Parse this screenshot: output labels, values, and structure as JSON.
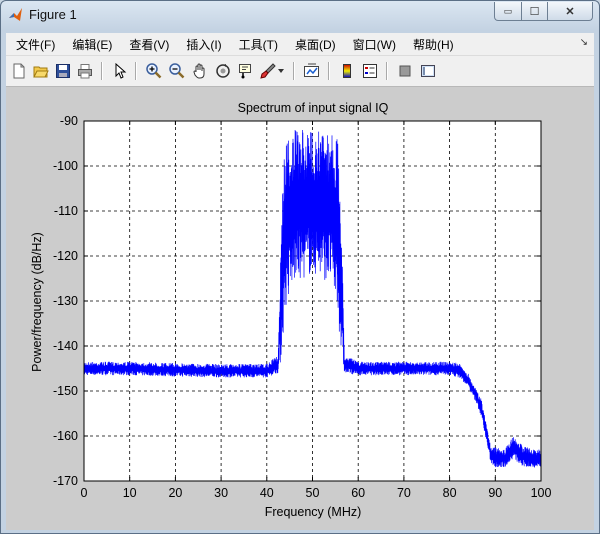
{
  "window": {
    "title": "Figure 1",
    "buttons": {
      "minimize": "▭",
      "maximize": "☐",
      "close": "✕"
    }
  },
  "menu": {
    "items": [
      "文件(F)",
      "编辑(E)",
      "查看(V)",
      "插入(I)",
      "工具(T)",
      "桌面(D)",
      "窗口(W)",
      "帮助(H)"
    ],
    "overflow_arrow": "↘"
  },
  "toolbar": {
    "icons": [
      "new-figure-icon",
      "open-file-icon",
      "save-icon",
      "print-icon",
      "edit-plot-arrow-icon",
      "zoom-in-icon",
      "zoom-out-icon",
      "pan-hand-icon",
      "rotate-3d-icon",
      "data-cursor-icon",
      "brush-icon",
      "brush-dropdown-icon",
      "link-plot-icon",
      "insert-colorbar-icon",
      "insert-legend-icon",
      "hide-plot-tools-icon",
      "show-plot-tools-icon"
    ]
  },
  "colors": {
    "line": "#0000ff",
    "axes_bg": "#ffffff",
    "figure_bg": "#cccccc"
  },
  "chart_data": {
    "type": "line",
    "title": "Spectrum of input signal IQ",
    "xlabel": "Frequency (MHz)",
    "ylabel": "Power/frequency (dB/Hz)",
    "xlim": [
      0,
      100
    ],
    "ylim": [
      -170,
      -90
    ],
    "xticks": [
      0,
      10,
      20,
      30,
      40,
      50,
      60,
      70,
      80,
      90,
      100
    ],
    "yticks": [
      -90,
      -100,
      -110,
      -120,
      -130,
      -140,
      -150,
      -160,
      -170
    ],
    "grid": true,
    "series": [
      {
        "color": "#0000ff",
        "upper": [
          [
            0,
            -143.5
          ],
          [
            10,
            -143.5
          ],
          [
            20,
            -143.8
          ],
          [
            30,
            -144
          ],
          [
            40,
            -144
          ],
          [
            42.5,
            -142
          ],
          [
            43.2,
            -110
          ],
          [
            44,
            -94
          ],
          [
            46,
            -92
          ],
          [
            50,
            -92
          ],
          [
            54,
            -92
          ],
          [
            55.5,
            -94
          ],
          [
            56.3,
            -110
          ],
          [
            57,
            -142
          ],
          [
            60,
            -143.5
          ],
          [
            70,
            -143.5
          ],
          [
            80,
            -143.5
          ],
          [
            82,
            -143.8
          ],
          [
            84,
            -146
          ],
          [
            86,
            -150
          ],
          [
            87,
            -152
          ],
          [
            88,
            -157
          ],
          [
            89,
            -162
          ],
          [
            90,
            -162.5
          ],
          [
            92,
            -163
          ],
          [
            94,
            -160
          ],
          [
            96,
            -162
          ],
          [
            98,
            -163
          ],
          [
            100,
            -163
          ]
        ],
        "lower": [
          [
            0,
            -146.5
          ],
          [
            10,
            -146.5
          ],
          [
            20,
            -146.8
          ],
          [
            30,
            -147
          ],
          [
            40,
            -147
          ],
          [
            42.5,
            -146
          ],
          [
            43.2,
            -143
          ],
          [
            44,
            -132
          ],
          [
            46,
            -126
          ],
          [
            50,
            -124
          ],
          [
            54,
            -126
          ],
          [
            55.5,
            -132
          ],
          [
            56.3,
            -143
          ],
          [
            57,
            -146
          ],
          [
            60,
            -146.5
          ],
          [
            70,
            -146.5
          ],
          [
            80,
            -146.5
          ],
          [
            82,
            -147
          ],
          [
            84,
            -149
          ],
          [
            86,
            -153
          ],
          [
            87,
            -156
          ],
          [
            88,
            -161
          ],
          [
            89,
            -166
          ],
          [
            90,
            -167
          ],
          [
            92,
            -167
          ],
          [
            94,
            -165
          ],
          [
            96,
            -167
          ],
          [
            98,
            -167
          ],
          [
            100,
            -167
          ]
        ]
      }
    ]
  }
}
